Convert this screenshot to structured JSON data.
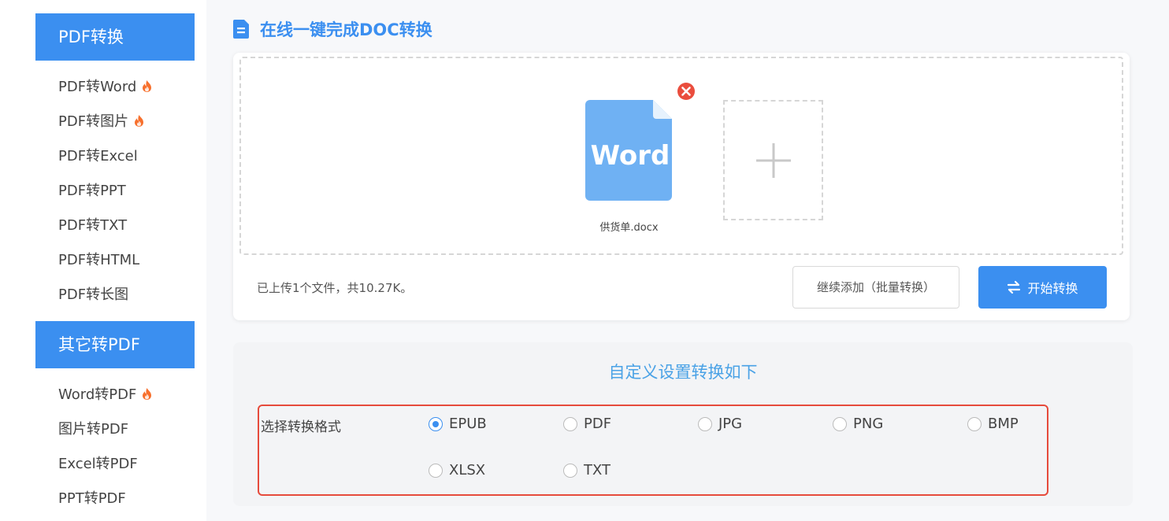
{
  "sidebar": {
    "sections": [
      {
        "header": "PDF转换",
        "items": [
          {
            "label": "PDF转Word",
            "hot": true
          },
          {
            "label": "PDF转图片",
            "hot": true
          },
          {
            "label": "PDF转Excel",
            "hot": false
          },
          {
            "label": "PDF转PPT",
            "hot": false
          },
          {
            "label": "PDF转TXT",
            "hot": false
          },
          {
            "label": "PDF转HTML",
            "hot": false
          },
          {
            "label": "PDF转长图",
            "hot": false
          }
        ]
      },
      {
        "header": "其它转PDF",
        "items": [
          {
            "label": "Word转PDF",
            "hot": true
          },
          {
            "label": "图片转PDF",
            "hot": false
          },
          {
            "label": "Excel转PDF",
            "hot": false
          },
          {
            "label": "PPT转PDF",
            "hot": false
          }
        ]
      }
    ]
  },
  "main": {
    "title": "在线一键完成DOC转换",
    "upload": {
      "file_icon_text": "Word",
      "file_name": "供货单.docx",
      "status": "已上传1个文件，共10.27K。",
      "add_more_label": "继续添加（批量转换）",
      "start_label": "开始转换"
    },
    "settings": {
      "title": "自定义设置转换如下",
      "format_label": "选择转换格式",
      "formats": [
        "EPUB",
        "PDF",
        "JPG",
        "PNG",
        "BMP",
        "XLSX",
        "TXT"
      ],
      "selected": "EPUB"
    }
  },
  "colors": {
    "accent": "#3b8ff0",
    "highlight_border": "#e64b3c",
    "file_icon": "#6fb1f3",
    "remove": "#ea4d3d",
    "hot": "#f7702d"
  },
  "icons": {
    "hot": "fire-icon",
    "title": "document-icon",
    "remove": "close-circle-icon",
    "add": "plus-icon",
    "start": "swap-icon"
  }
}
